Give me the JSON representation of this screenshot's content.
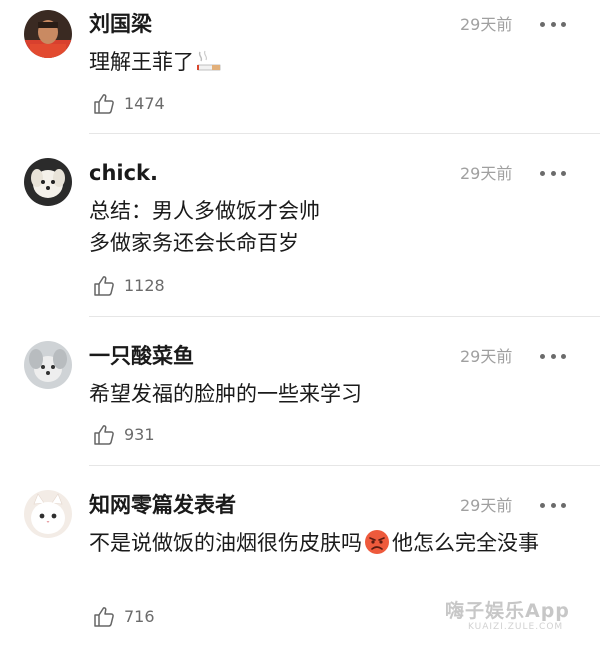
{
  "comments": [
    {
      "username": "刘国梁",
      "time": "29天前",
      "text": "理解王菲了",
      "likes": "1474",
      "avatar": "person-avatar",
      "inline_emoji": "cigarette-emoji"
    },
    {
      "username": "chick.",
      "time": "29天前",
      "text": "总结：男人多做饭才会帅\n多做家务还会长命百岁",
      "likes": "1128",
      "avatar": "white-dog-avatar"
    },
    {
      "username": "一只酸菜鱼",
      "time": "29天前",
      "text": "希望发福的脸肿的一些来学习",
      "likes": "931",
      "avatar": "dog-avatar"
    },
    {
      "username": "知网零篇发表者",
      "time": "29天前",
      "text_before": "不是说做饭的油烟很伤皮肤吗",
      "text_after": "他怎么完全没事",
      "likes": "716",
      "avatar": "white-cat-avatar",
      "inline_emoji": "angry-face-emoji"
    }
  ],
  "watermark": {
    "text": "嗨子娱乐App",
    "sub": "KUAIZI.ZULE.COM"
  },
  "colors": {
    "text": "#1a1a1a",
    "muted": "#a0a0a0",
    "divider": "#e6e6e6"
  }
}
